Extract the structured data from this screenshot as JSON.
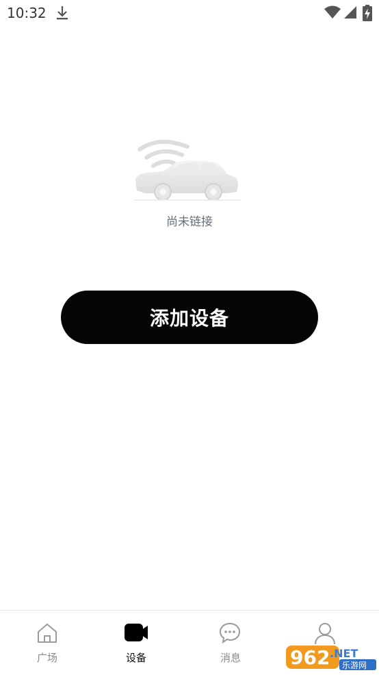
{
  "status_bar": {
    "time": "10:32",
    "icons": [
      "download-icon",
      "wifi-icon",
      "signal-icon",
      "battery-icon"
    ]
  },
  "main": {
    "illustration": "car-wifi-icon",
    "status_text": "尚未链接",
    "add_device_label": "添加设备"
  },
  "bottom_nav": {
    "active": "设备",
    "items": [
      {
        "label": "广场",
        "icon": "home-icon"
      },
      {
        "label": "设备",
        "icon": "video-camera-icon"
      },
      {
        "label": "消息",
        "icon": "chat-bubble-icon"
      },
      {
        "label": "",
        "icon": "person-icon"
      }
    ]
  },
  "watermark": {
    "brand": "962.NET",
    "sub": "乐游网"
  },
  "colors": {
    "button_bg": "#050505",
    "button_text": "#ffffff",
    "status_text": "#666e78",
    "nav_inactive": "#888888",
    "nav_active": "#111111"
  }
}
